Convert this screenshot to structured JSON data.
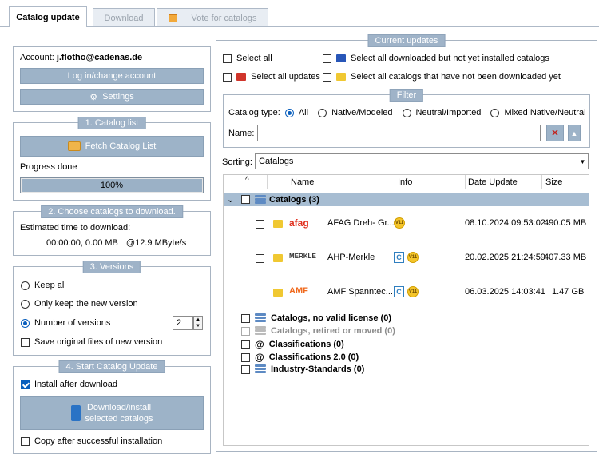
{
  "tabs": [
    {
      "label": "Catalog update"
    },
    {
      "label": "Download"
    },
    {
      "label": "Vote for catalogs"
    }
  ],
  "account": {
    "label": "Account:",
    "email": "j.flotho@cadenas.de",
    "login_button": "Log in/change account",
    "settings_button": "Settings"
  },
  "catalog_list": {
    "legend": "1. Catalog list",
    "fetch_button": "Fetch Catalog List",
    "progress_label": "Progress done",
    "progress_value": 1.0,
    "progress_text": "100%"
  },
  "choose": {
    "legend": "2. Choose catalogs to download.",
    "estimated_label": "Estimated time to download:",
    "estimated_value": "00:00:00, 0.00 MB",
    "rate": "@12.9 MByte/s"
  },
  "versions": {
    "legend": "3. Versions",
    "options": [
      "Keep all",
      "Only keep the new version",
      "Number of versions"
    ],
    "selected": "Number of versions",
    "number": "2",
    "save_original": "Save original files of new version"
  },
  "start": {
    "legend": "4. Start Catalog Update",
    "install_after": "Install after download",
    "download_button_line1": "Download/install",
    "download_button_line2": "selected catalogs",
    "copy_after": "Copy after successful installation"
  },
  "current": {
    "legend": "Current updates",
    "select_all": "Select all",
    "select_all_updates": "Select all updates",
    "select_downloaded": "Select all downloaded but not yet installed catalogs",
    "select_not_downloaded": "Select all catalogs that have not been downloaded yet"
  },
  "filter": {
    "legend": "Filter",
    "catalog_type_label": "Catalog type:",
    "types": [
      "All",
      "Native/Modeled",
      "Neutral/Imported",
      "Mixed Native/Neutral"
    ],
    "selected_type": "All",
    "name_label": "Name:",
    "name_value": ""
  },
  "sorting": {
    "label": "Sorting:",
    "value": "Catalogs"
  },
  "table": {
    "headers": [
      "Name",
      "Info",
      "Date Update",
      "Size"
    ],
    "sort_indicator": "^",
    "group": {
      "label": "Catalogs (3)",
      "toggle": "⌄"
    },
    "rows": [
      {
        "logo": "afag",
        "name": "AFAG Dreh- Gr...",
        "info": [
          "V11"
        ],
        "date": "08.10.2024 09:53:02",
        "size": "490.05 MB"
      },
      {
        "logo": "MERKLE",
        "name": "AHP-Merkle",
        "info": [
          "C",
          "V11"
        ],
        "date": "20.02.2025 21:24:59",
        "size": "407.33 MB"
      },
      {
        "logo": "AMF",
        "name": "AMF Spanntec...",
        "info": [
          "C",
          "V11"
        ],
        "date": "06.03.2025 14:03:41",
        "size": "1.47 GB"
      }
    ],
    "other_groups": [
      {
        "label": "Catalogs, no valid license (0)",
        "dim": false,
        "icon": "stack-icon"
      },
      {
        "label": "Catalogs, retired or moved (0)",
        "dim": true,
        "icon": "stack-icon"
      },
      {
        "label": "Classifications (0)",
        "dim": false,
        "icon": "at-icon"
      },
      {
        "label": "Classifications 2.0 (0)",
        "dim": false,
        "icon": "at-icon"
      },
      {
        "label": "Industry-Standards (0)",
        "dim": false,
        "icon": "stack-icon"
      }
    ]
  },
  "colors": {
    "accent": "#0a5fbd",
    "legend_bg": "#9fb3c8",
    "button_bg": "#9db3c8",
    "group_row_bg": "#a7bdd2"
  }
}
